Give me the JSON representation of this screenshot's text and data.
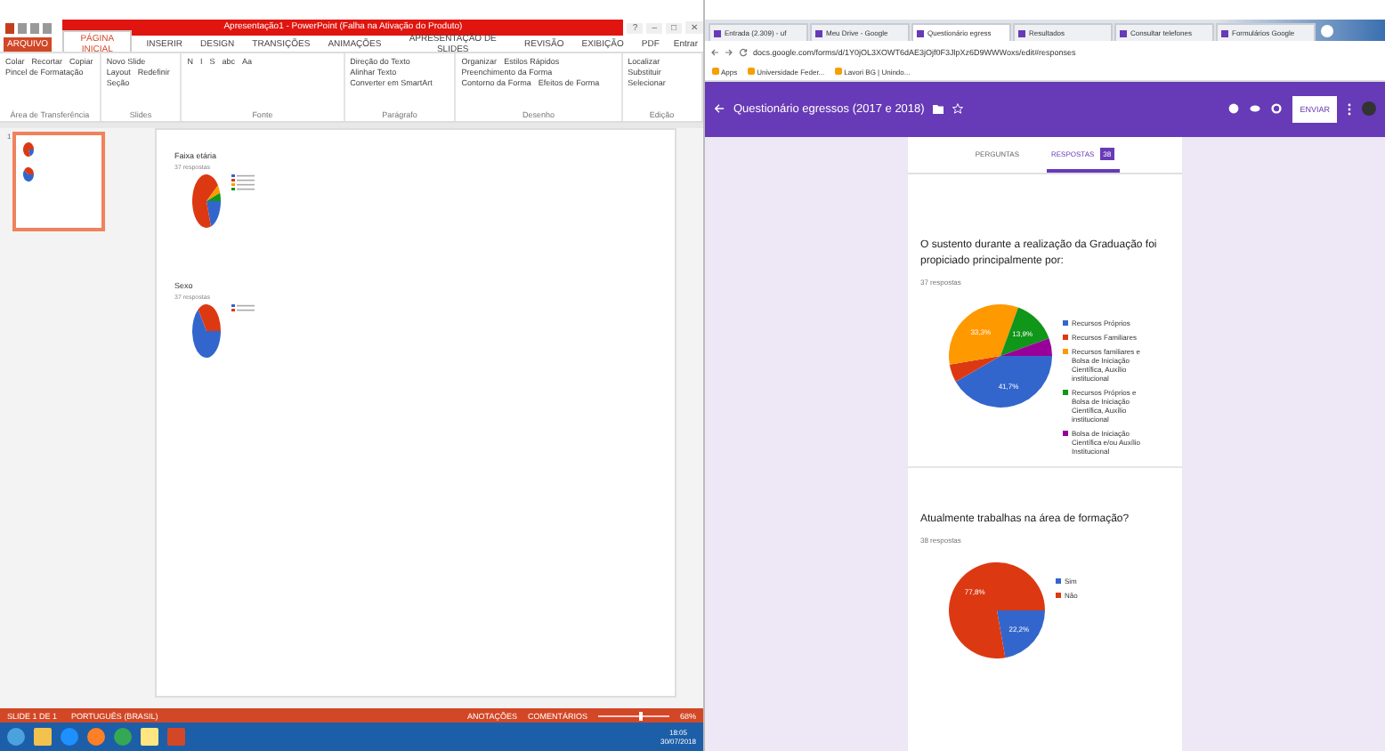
{
  "powerpoint": {
    "title": "Apresentação1 - PowerPoint (Falha na Ativação do Produto)",
    "window_controls": [
      "?",
      "–",
      "□",
      "✕"
    ],
    "ribbon_tabs": [
      {
        "label": "ARQUIVO",
        "selected": false
      },
      {
        "label": "PÁGINA INICIAL",
        "selected": true
      },
      {
        "label": "INSERIR",
        "selected": false
      },
      {
        "label": "DESIGN",
        "selected": false
      },
      {
        "label": "TRANSIÇÕES",
        "selected": false
      },
      {
        "label": "ANIMAÇÕES",
        "selected": false
      },
      {
        "label": "APRESENTAÇÃO DE SLIDES",
        "selected": false
      },
      {
        "label": "REVISÃO",
        "selected": false
      },
      {
        "label": "EXIBIÇÃO",
        "selected": false
      },
      {
        "label": "PDF",
        "selected": false
      }
    ],
    "account": "Entrar",
    "ribbon_groups": [
      {
        "label": "Área de Transferência",
        "buttons": [
          "Colar",
          "Recortar",
          "Copiar",
          "Pincel de Formatação"
        ]
      },
      {
        "label": "Slides",
        "buttons": [
          "Novo Slide",
          "Layout",
          "Redefinir",
          "Seção"
        ]
      },
      {
        "label": "Fonte",
        "buttons": [
          "N",
          "I",
          "S",
          "abc",
          "Aa"
        ]
      },
      {
        "label": "Parágrafo",
        "buttons": [
          "Direção do Texto",
          "Alinhar Texto",
          "Converter em SmartArt"
        ]
      },
      {
        "label": "Desenho",
        "buttons": [
          "Organizar",
          "Estilos Rápidos",
          "Preenchimento da Forma",
          "Contorno da Forma",
          "Efeitos de Forma"
        ]
      },
      {
        "label": "Edição",
        "buttons": [
          "Localizar",
          "Substituir",
          "Selecionar"
        ]
      }
    ],
    "slides": [
      {
        "number": "1",
        "selected": true
      }
    ],
    "slide": {
      "charts": [
        {
          "title": "Faixa etária",
          "subtitle": "37 respostas"
        },
        {
          "title": "Sexo",
          "subtitle": "37 respostas"
        }
      ]
    },
    "status_bar": {
      "left": [
        "SLIDE 1 DE 1",
        "PORTUGUÊS (BRASIL)"
      ],
      "right": [
        "ANOTAÇÕES",
        "COMENTÁRIOS"
      ],
      "zoom": "68%",
      "level": 0.6
    }
  },
  "taskbar": {
    "apps": [
      {
        "kind": "start"
      },
      {
        "kind": "folder"
      },
      {
        "kind": "ie"
      },
      {
        "kind": "firefox"
      },
      {
        "kind": "chrome"
      },
      {
        "kind": "notes"
      },
      {
        "kind": "powerpoint"
      }
    ],
    "time": "18:05",
    "date": "30/07/2018"
  },
  "browser": {
    "tabs": [
      {
        "label": "Entrada (2.309) - uf",
        "selected": false
      },
      {
        "label": "Meu Drive - Google",
        "selected": false
      },
      {
        "label": "Questionário egress",
        "selected": true
      },
      {
        "label": "Resultados",
        "selected": false
      },
      {
        "label": "Consultar telefones",
        "selected": false
      },
      {
        "label": "Formulários Google",
        "selected": false
      }
    ],
    "url": "docs.google.com/forms/d/1Y0jOL3XOWT6dAE3jOjf0F3JlpXz6D9WWWoxs/edit#responses",
    "bookmarks": [
      "Apps",
      "Universidade Feder...",
      "Lavori BG | Unindo..."
    ],
    "form": {
      "title": "Questionário egressos (2017 e 2018)",
      "send": "ENVIAR",
      "tabs": [
        {
          "label": "PERGUNTAS",
          "selected": false
        },
        {
          "label": "RESPOSTAS",
          "selected": true,
          "badge": "38"
        }
      ],
      "questions": [
        {
          "title": "O sustento durante a realização da Graduação foi propiciado principalmente por:",
          "responses": "37 respostas",
          "chart_data": {
            "type": "pie",
            "categories": [
              "Recursos Próprios",
              "Recursos Familiares",
              "Recursos familiares e Bolsa de Iniciação Científica, Auxílio institucional",
              "Recursos Próprios e Bolsa de Iniciação Científica, Auxílio institucional",
              "Bolsa de Iniciação Científica e/ou Auxílio Institucional"
            ],
            "colors": [
              "#3366cc",
              "#dc3912",
              "#ff9900",
              "#109618",
              "#990099"
            ],
            "series": [
              {
                "values": [
                  41.7,
                  5.6,
                  33.3,
                  13.9,
                  5.5
                ]
              }
            ],
            "value_labels": [
              "41,7%",
              null,
              "33,3%",
              "13,9%",
              null
            ],
            "legend": true
          }
        },
        {
          "title": "Atualmente trabalhas na área de formação?",
          "responses": "38 respostas",
          "chart_data": {
            "type": "pie",
            "categories": [
              "Sim",
              "Não"
            ],
            "colors": [
              "#3366cc",
              "#dc3912"
            ],
            "series": [
              {
                "values": [
                  22.2,
                  77.8
                ]
              }
            ],
            "value_labels": [
              "22,2%",
              "77,8%"
            ],
            "legend": true
          }
        }
      ]
    }
  }
}
